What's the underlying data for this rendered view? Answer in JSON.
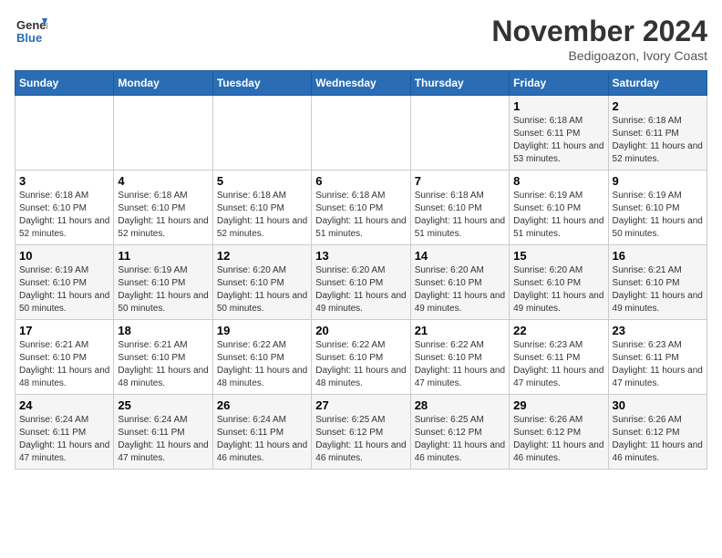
{
  "logo": {
    "line1": "General",
    "line2": "Blue"
  },
  "header": {
    "month": "November 2024",
    "location": "Bedigoazon, Ivory Coast"
  },
  "weekdays": [
    "Sunday",
    "Monday",
    "Tuesday",
    "Wednesday",
    "Thursday",
    "Friday",
    "Saturday"
  ],
  "weeks": [
    [
      {
        "day": "",
        "info": ""
      },
      {
        "day": "",
        "info": ""
      },
      {
        "day": "",
        "info": ""
      },
      {
        "day": "",
        "info": ""
      },
      {
        "day": "",
        "info": ""
      },
      {
        "day": "1",
        "info": "Sunrise: 6:18 AM\nSunset: 6:11 PM\nDaylight: 11 hours and 53 minutes."
      },
      {
        "day": "2",
        "info": "Sunrise: 6:18 AM\nSunset: 6:11 PM\nDaylight: 11 hours and 52 minutes."
      }
    ],
    [
      {
        "day": "3",
        "info": "Sunrise: 6:18 AM\nSunset: 6:10 PM\nDaylight: 11 hours and 52 minutes."
      },
      {
        "day": "4",
        "info": "Sunrise: 6:18 AM\nSunset: 6:10 PM\nDaylight: 11 hours and 52 minutes."
      },
      {
        "day": "5",
        "info": "Sunrise: 6:18 AM\nSunset: 6:10 PM\nDaylight: 11 hours and 52 minutes."
      },
      {
        "day": "6",
        "info": "Sunrise: 6:18 AM\nSunset: 6:10 PM\nDaylight: 11 hours and 51 minutes."
      },
      {
        "day": "7",
        "info": "Sunrise: 6:18 AM\nSunset: 6:10 PM\nDaylight: 11 hours and 51 minutes."
      },
      {
        "day": "8",
        "info": "Sunrise: 6:19 AM\nSunset: 6:10 PM\nDaylight: 11 hours and 51 minutes."
      },
      {
        "day": "9",
        "info": "Sunrise: 6:19 AM\nSunset: 6:10 PM\nDaylight: 11 hours and 50 minutes."
      }
    ],
    [
      {
        "day": "10",
        "info": "Sunrise: 6:19 AM\nSunset: 6:10 PM\nDaylight: 11 hours and 50 minutes."
      },
      {
        "day": "11",
        "info": "Sunrise: 6:19 AM\nSunset: 6:10 PM\nDaylight: 11 hours and 50 minutes."
      },
      {
        "day": "12",
        "info": "Sunrise: 6:20 AM\nSunset: 6:10 PM\nDaylight: 11 hours and 50 minutes."
      },
      {
        "day": "13",
        "info": "Sunrise: 6:20 AM\nSunset: 6:10 PM\nDaylight: 11 hours and 49 minutes."
      },
      {
        "day": "14",
        "info": "Sunrise: 6:20 AM\nSunset: 6:10 PM\nDaylight: 11 hours and 49 minutes."
      },
      {
        "day": "15",
        "info": "Sunrise: 6:20 AM\nSunset: 6:10 PM\nDaylight: 11 hours and 49 minutes."
      },
      {
        "day": "16",
        "info": "Sunrise: 6:21 AM\nSunset: 6:10 PM\nDaylight: 11 hours and 49 minutes."
      }
    ],
    [
      {
        "day": "17",
        "info": "Sunrise: 6:21 AM\nSunset: 6:10 PM\nDaylight: 11 hours and 48 minutes."
      },
      {
        "day": "18",
        "info": "Sunrise: 6:21 AM\nSunset: 6:10 PM\nDaylight: 11 hours and 48 minutes."
      },
      {
        "day": "19",
        "info": "Sunrise: 6:22 AM\nSunset: 6:10 PM\nDaylight: 11 hours and 48 minutes."
      },
      {
        "day": "20",
        "info": "Sunrise: 6:22 AM\nSunset: 6:10 PM\nDaylight: 11 hours and 48 minutes."
      },
      {
        "day": "21",
        "info": "Sunrise: 6:22 AM\nSunset: 6:10 PM\nDaylight: 11 hours and 47 minutes."
      },
      {
        "day": "22",
        "info": "Sunrise: 6:23 AM\nSunset: 6:11 PM\nDaylight: 11 hours and 47 minutes."
      },
      {
        "day": "23",
        "info": "Sunrise: 6:23 AM\nSunset: 6:11 PM\nDaylight: 11 hours and 47 minutes."
      }
    ],
    [
      {
        "day": "24",
        "info": "Sunrise: 6:24 AM\nSunset: 6:11 PM\nDaylight: 11 hours and 47 minutes."
      },
      {
        "day": "25",
        "info": "Sunrise: 6:24 AM\nSunset: 6:11 PM\nDaylight: 11 hours and 47 minutes."
      },
      {
        "day": "26",
        "info": "Sunrise: 6:24 AM\nSunset: 6:11 PM\nDaylight: 11 hours and 46 minutes."
      },
      {
        "day": "27",
        "info": "Sunrise: 6:25 AM\nSunset: 6:12 PM\nDaylight: 11 hours and 46 minutes."
      },
      {
        "day": "28",
        "info": "Sunrise: 6:25 AM\nSunset: 6:12 PM\nDaylight: 11 hours and 46 minutes."
      },
      {
        "day": "29",
        "info": "Sunrise: 6:26 AM\nSunset: 6:12 PM\nDaylight: 11 hours and 46 minutes."
      },
      {
        "day": "30",
        "info": "Sunrise: 6:26 AM\nSunset: 6:12 PM\nDaylight: 11 hours and 46 minutes."
      }
    ]
  ]
}
